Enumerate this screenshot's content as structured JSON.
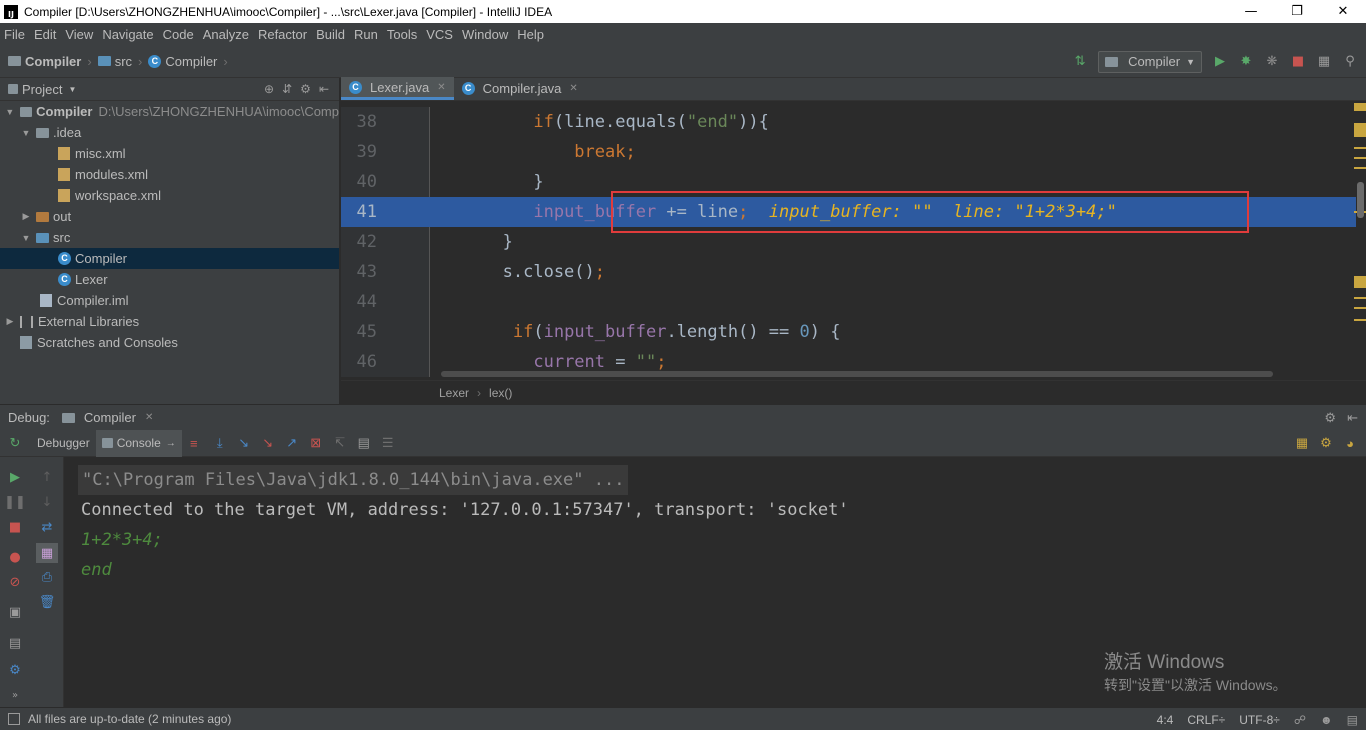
{
  "window": {
    "title": "Compiler [D:\\Users\\ZHONGZHENHUA\\imooc\\Compiler] - ...\\src\\Lexer.java [Compiler] - IntelliJ IDEA",
    "app_icon_text": "IJ"
  },
  "menu": [
    "File",
    "Edit",
    "View",
    "Navigate",
    "Code",
    "Analyze",
    "Refactor",
    "Build",
    "Run",
    "Tools",
    "VCS",
    "Window",
    "Help"
  ],
  "navbar": {
    "crumbs": [
      "Compiler",
      "src",
      "Compiler"
    ],
    "run_config": "Compiler"
  },
  "project": {
    "header": "Project",
    "tree": [
      {
        "label": "Compiler",
        "path": "D:\\Users\\ZHONGZHENHUA\\imooc\\Comp"
      },
      {
        "label": ".idea"
      },
      {
        "label": "misc.xml"
      },
      {
        "label": "modules.xml"
      },
      {
        "label": "workspace.xml"
      },
      {
        "label": "out"
      },
      {
        "label": "src"
      },
      {
        "label": "Compiler"
      },
      {
        "label": "Lexer"
      },
      {
        "label": "Compiler.iml"
      },
      {
        "label": "External Libraries"
      },
      {
        "label": "Scratches and Consoles"
      }
    ]
  },
  "editor": {
    "tabs": [
      {
        "label": "Lexer.java",
        "active": true
      },
      {
        "label": "Compiler.java",
        "active": false
      }
    ],
    "lines": [
      {
        "n": "38"
      },
      {
        "n": "39"
      },
      {
        "n": "40"
      },
      {
        "n": "41",
        "debug_hint": "input_buffer: \"\"  line: \"1+2*3+4;\""
      },
      {
        "n": "42"
      },
      {
        "n": "43"
      },
      {
        "n": "44"
      },
      {
        "n": "45"
      },
      {
        "n": "46"
      }
    ],
    "breadcrumb": [
      "Lexer",
      "lex()"
    ]
  },
  "debug": {
    "title": "Debug:",
    "session": "Compiler",
    "tabs": [
      "Debugger",
      "Console"
    ],
    "console_lines": [
      "\"C:\\Program Files\\Java\\jdk1.8.0_144\\bin\\java.exe\" ...",
      "Connected to the target VM, address: '127.0.0.1:57347', transport: 'socket'",
      "1+2*3+4;",
      "end"
    ],
    "watermark_title": "激活 Windows",
    "watermark_sub": "转到\"设置\"以激活 Windows。"
  },
  "status": {
    "message": "All files are up-to-date (2 minutes ago)",
    "position": "4:4",
    "line_sep": "CRLF÷",
    "encoding": "UTF-8÷"
  },
  "colors": {
    "background": "#2b2b2b",
    "panel": "#3c3f41",
    "selection": "#2d5aa0",
    "highlight_box": "#e03c3c",
    "keyword": "#cc7832",
    "string": "#6a8759"
  }
}
